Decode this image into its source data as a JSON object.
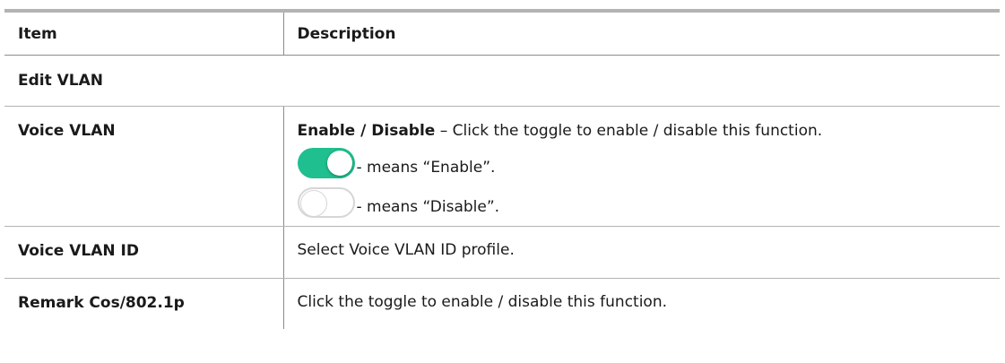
{
  "table": {
    "header": {
      "item": "Item",
      "description": "Description"
    },
    "section_title": "Edit VLAN",
    "rows": [
      {
        "item": "Voice VLAN",
        "desc_bold": "Enable / Disable",
        "desc_rest": " – Click the toggle to enable / disable this function.",
        "toggle_on_text": "- means “Enable”.",
        "toggle_off_text": "- means “Disable”."
      },
      {
        "item": "Voice VLAN ID",
        "description": "Select Voice VLAN ID profile."
      },
      {
        "item": "Remark Cos/802.1p",
        "description": "Click the toggle to enable / disable this function."
      }
    ]
  },
  "colors": {
    "toggle_on": "#1fbf8f",
    "toggle_off_border": "#d6d6d6",
    "rule": "#b3b3b3"
  },
  "icons": [
    "toggle-on-icon",
    "toggle-off-icon"
  ]
}
